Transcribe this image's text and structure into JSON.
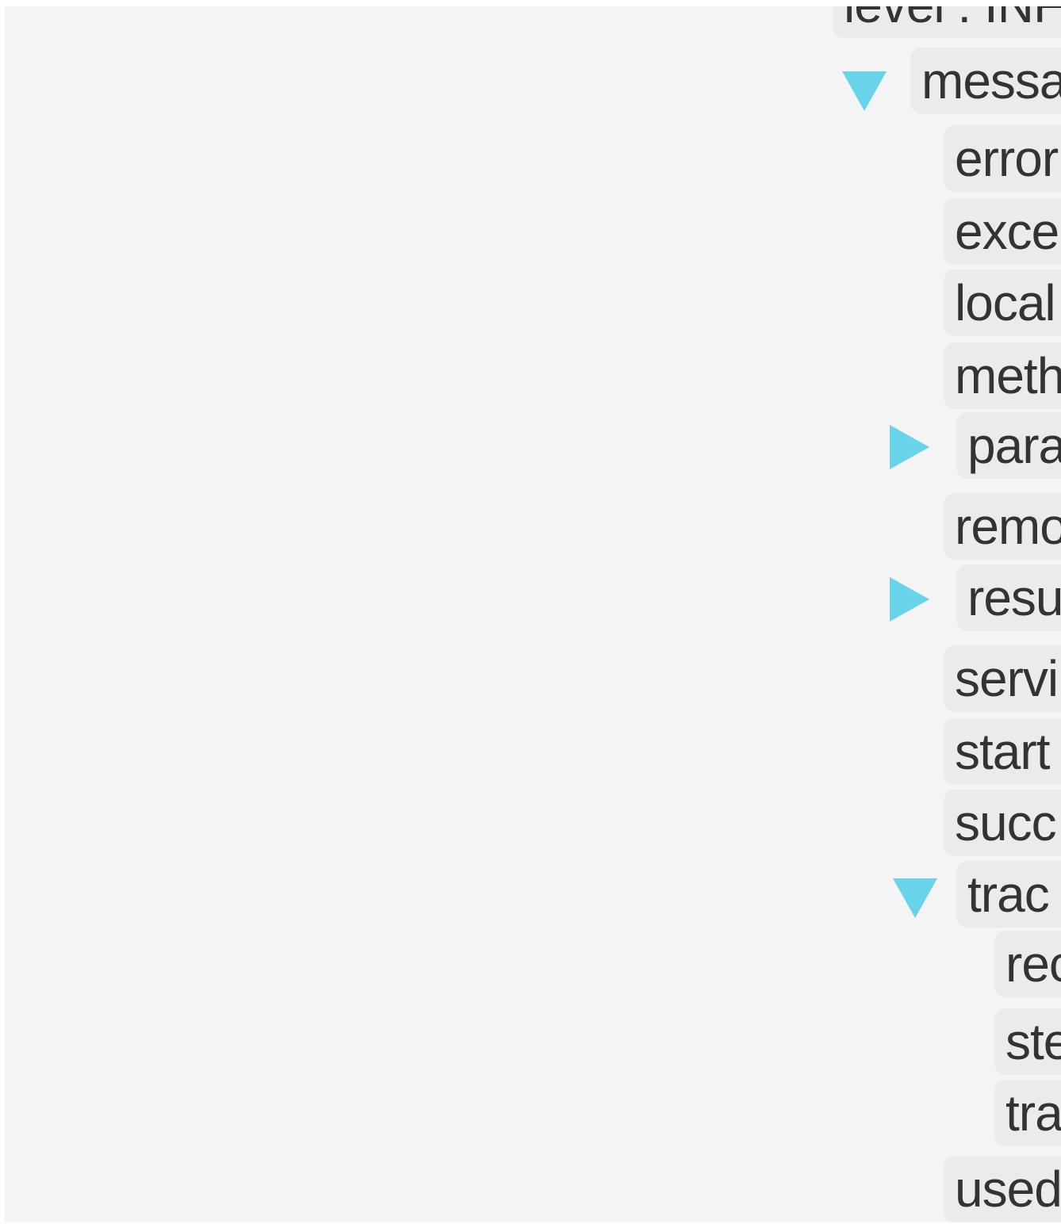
{
  "tree": {
    "colors": {
      "background": "#f4f4f4",
      "key_background": "#ebebeb",
      "text": "#333333",
      "caret": "#69d3e9"
    },
    "top_partial": "level : INF",
    "message": {
      "label": "messa",
      "expanded": true,
      "children": {
        "error": "error",
        "exception": "exce",
        "local": "local",
        "method": "meth",
        "params": {
          "label": "para",
          "expanded": false
        },
        "remote": "remo",
        "result": {
          "label": "resu",
          "expanded": false
        },
        "service": "servi",
        "start": "start",
        "success": "succ",
        "trace": {
          "label": "trac",
          "expanded": true,
          "children": {
            "req": "rec",
            "step": "ste",
            "tra": "tra"
          }
        },
        "used": "used"
      }
    }
  }
}
